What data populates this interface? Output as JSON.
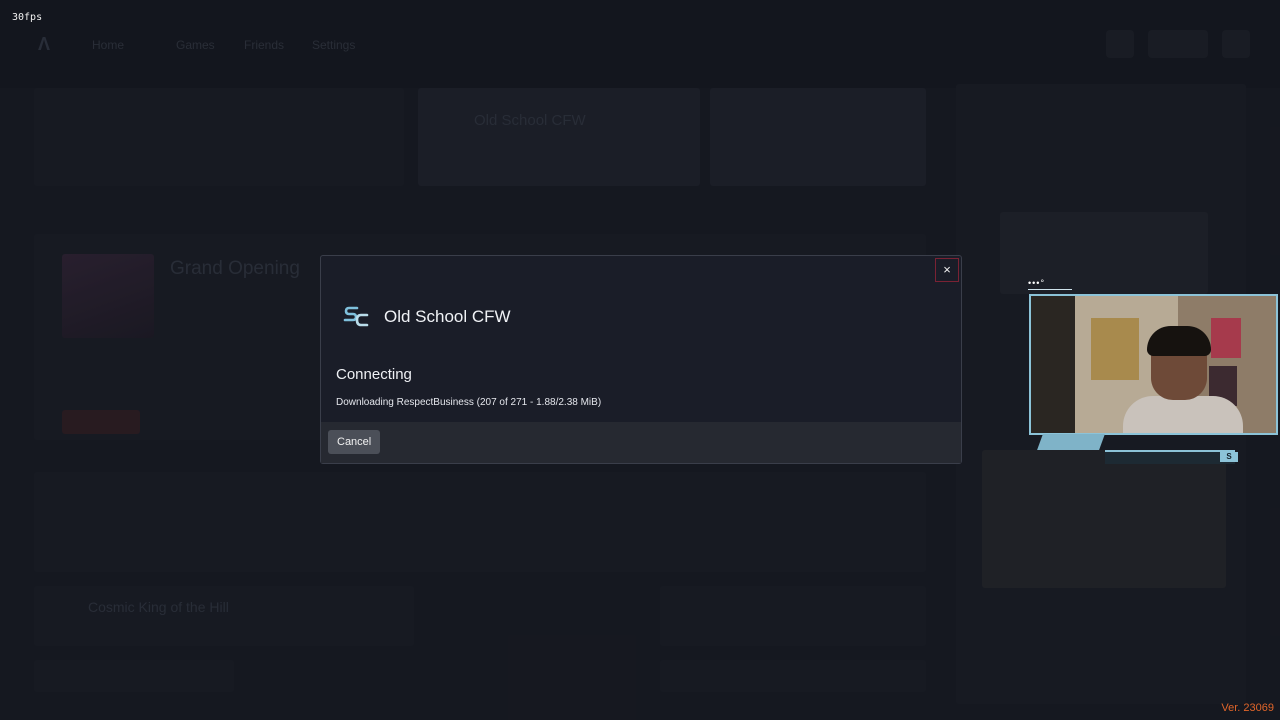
{
  "overlay": {
    "fps": "30fps",
    "version": "Ver. 23069"
  },
  "background": {
    "nav": [
      "Home",
      "Games",
      "Friends",
      "Settings"
    ],
    "server_card_title": "Old School CFW",
    "featured_title": "Grand Opening",
    "event_title": "Cosmic King of the Hill"
  },
  "dialog": {
    "server_name": "Old School CFW",
    "status": "Connecting",
    "progress": "Downloading RespectBusiness (207 of 271 - 1.88/2.38 MiB)",
    "cancel_label": "Cancel",
    "close_label": "×"
  },
  "webcam": {
    "dots_label": "•••°",
    "badge": "S"
  },
  "colors": {
    "accent": "#8cc3d8",
    "version": "#e0652a",
    "close_border": "#7a2234"
  }
}
